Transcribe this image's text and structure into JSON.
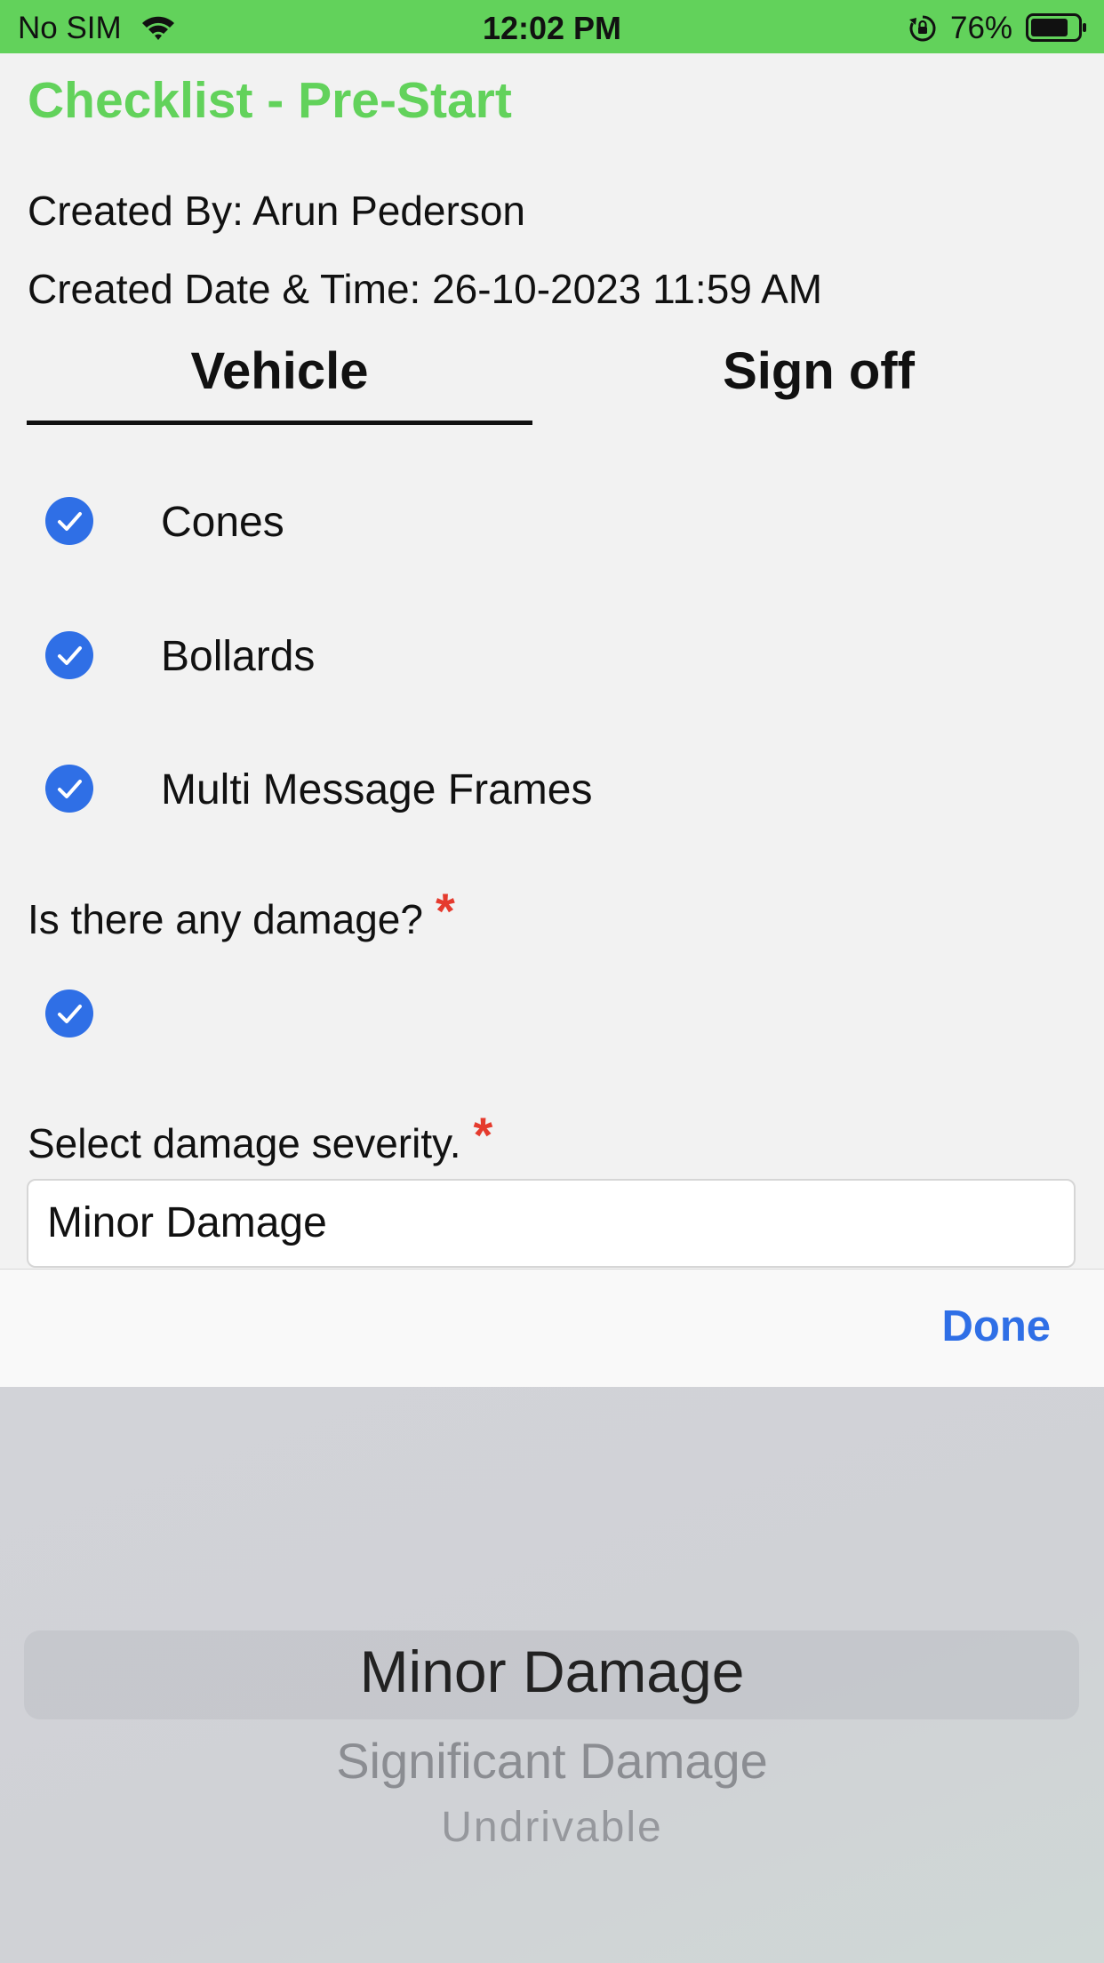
{
  "status_bar": {
    "carrier": "No SIM",
    "time": "12:02 PM",
    "battery_percent": "76%",
    "icons": [
      "wifi-icon",
      "orientation-lock-icon",
      "battery-icon"
    ]
  },
  "header": {
    "title": "Checklist - Pre-Start",
    "created_by": "Created By: Arun Pederson",
    "created_date": "Created Date & Time: 26-10-2023 11:59 AM"
  },
  "tabs": [
    {
      "label": "Vehicle",
      "active": true
    },
    {
      "label": "Sign off",
      "active": false
    }
  ],
  "checklist": [
    {
      "label": "Cones",
      "checked": true
    },
    {
      "label": "Bollards",
      "checked": true
    },
    {
      "label": "Multi Message Frames",
      "checked": true
    }
  ],
  "damage_question": {
    "label": "Is there any damage?",
    "required_mark": "*",
    "checked": true
  },
  "severity": {
    "label": "Select damage severity.",
    "required_mark": "*",
    "value": "Minor Damage"
  },
  "picker": {
    "done_label": "Done",
    "options": [
      "Minor Damage",
      "Significant Damage",
      "Undrivable"
    ],
    "selected": "Minor Damage"
  },
  "colors": {
    "brand_green": "#62d25b",
    "accent_blue": "#2f6fe6",
    "required_red": "#e53b2e"
  }
}
